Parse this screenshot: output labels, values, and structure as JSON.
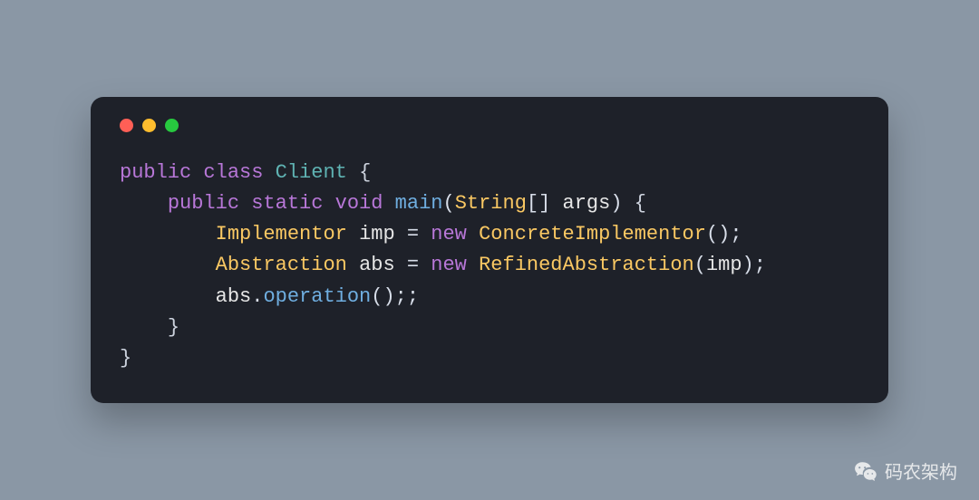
{
  "window": {
    "traffic_lights": [
      "red",
      "yellow",
      "green"
    ]
  },
  "code": {
    "tokens": [
      [
        {
          "t": "public",
          "c": "kw"
        },
        {
          "t": " ",
          "c": ""
        },
        {
          "t": "class",
          "c": "kw"
        },
        {
          "t": " ",
          "c": ""
        },
        {
          "t": "Client",
          "c": "type"
        },
        {
          "t": " ",
          "c": ""
        },
        {
          "t": "{",
          "c": "brace"
        }
      ],
      [
        {
          "t": "    ",
          "c": ""
        },
        {
          "t": "public",
          "c": "kw"
        },
        {
          "t": " ",
          "c": ""
        },
        {
          "t": "static",
          "c": "kw"
        },
        {
          "t": " ",
          "c": ""
        },
        {
          "t": "void",
          "c": "kw"
        },
        {
          "t": " ",
          "c": ""
        },
        {
          "t": "main",
          "c": "method"
        },
        {
          "t": "(",
          "c": "paren"
        },
        {
          "t": "String",
          "c": "cls"
        },
        {
          "t": "[]",
          "c": "punct"
        },
        {
          "t": " ",
          "c": ""
        },
        {
          "t": "args",
          "c": "var"
        },
        {
          "t": ")",
          "c": "paren"
        },
        {
          "t": " ",
          "c": ""
        },
        {
          "t": "{",
          "c": "brace"
        }
      ],
      [
        {
          "t": "        ",
          "c": ""
        },
        {
          "t": "Implementor",
          "c": "cls"
        },
        {
          "t": " ",
          "c": ""
        },
        {
          "t": "imp",
          "c": "var"
        },
        {
          "t": " ",
          "c": ""
        },
        {
          "t": "=",
          "c": "punct"
        },
        {
          "t": " ",
          "c": ""
        },
        {
          "t": "new",
          "c": "kw"
        },
        {
          "t": " ",
          "c": ""
        },
        {
          "t": "ConcreteImplementor",
          "c": "cls"
        },
        {
          "t": "(",
          "c": "paren"
        },
        {
          "t": ")",
          "c": "paren"
        },
        {
          "t": ";",
          "c": "punct"
        }
      ],
      [
        {
          "t": "        ",
          "c": ""
        },
        {
          "t": "Abstraction",
          "c": "cls"
        },
        {
          "t": " ",
          "c": ""
        },
        {
          "t": "abs",
          "c": "var"
        },
        {
          "t": " ",
          "c": ""
        },
        {
          "t": "=",
          "c": "punct"
        },
        {
          "t": " ",
          "c": ""
        },
        {
          "t": "new",
          "c": "kw"
        },
        {
          "t": " ",
          "c": ""
        },
        {
          "t": "RefinedAbstraction",
          "c": "cls"
        },
        {
          "t": "(",
          "c": "paren"
        },
        {
          "t": "imp",
          "c": "var"
        },
        {
          "t": ")",
          "c": "paren"
        },
        {
          "t": ";",
          "c": "punct"
        }
      ],
      [
        {
          "t": "        ",
          "c": ""
        },
        {
          "t": "abs",
          "c": "var"
        },
        {
          "t": ".",
          "c": "punct"
        },
        {
          "t": "operation",
          "c": "method"
        },
        {
          "t": "(",
          "c": "paren"
        },
        {
          "t": ")",
          "c": "paren"
        },
        {
          "t": ";",
          "c": "punct"
        },
        {
          "t": ";",
          "c": "punct"
        }
      ],
      [
        {
          "t": "    ",
          "c": ""
        },
        {
          "t": "}",
          "c": "brace"
        }
      ],
      [
        {
          "t": "}",
          "c": "brace"
        }
      ]
    ]
  },
  "watermark": {
    "text": "码农架构"
  }
}
